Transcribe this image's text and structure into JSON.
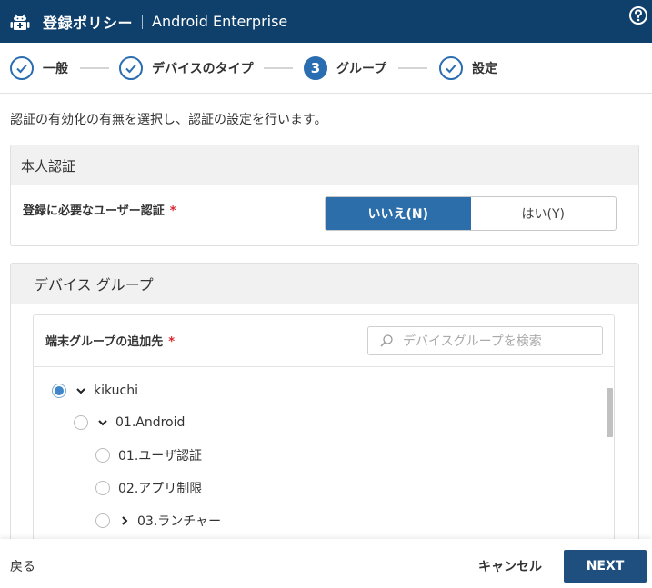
{
  "header": {
    "title": "登録ポリシー",
    "subtitle": "Android Enterprise",
    "background": "#0f3f6b"
  },
  "stepper": {
    "steps": [
      {
        "label": "一般",
        "state": "done"
      },
      {
        "label": "デバイスのタイプ",
        "state": "done"
      },
      {
        "label": "グループ",
        "state": "active",
        "number": "3"
      },
      {
        "label": "設定",
        "state": "done"
      }
    ],
    "accent": "#2a6db0"
  },
  "intro": "認証の有効化の有無を選択し、認証の設定を行います。",
  "auth_card": {
    "title": "本人認証",
    "row_label": "登録に必要なユーザー認証",
    "required_mark": "*",
    "options": [
      {
        "label": "いいえ(N)",
        "selected": true
      },
      {
        "label": "はい(Y)",
        "selected": false
      }
    ]
  },
  "group_card": {
    "title": "デバイス グループ",
    "label": "端末グループの追加先",
    "required_mark": "*",
    "search_placeholder": "デバイスグループを検索",
    "tree": [
      {
        "label": "kikuchi",
        "expander": "expanded",
        "selected": true
      },
      {
        "label": "01.Android",
        "expander": "expanded",
        "selected": false
      },
      {
        "label": "01.ユーザ認証",
        "expander": "none",
        "selected": false
      },
      {
        "label": "02.アプリ制限",
        "expander": "none",
        "selected": false
      },
      {
        "label": "03.ランチャー",
        "expander": "collapsed",
        "selected": false
      }
    ]
  },
  "footer": {
    "back_label": "戻る",
    "cancel_label": "キャンセル",
    "next_label": "NEXT"
  }
}
